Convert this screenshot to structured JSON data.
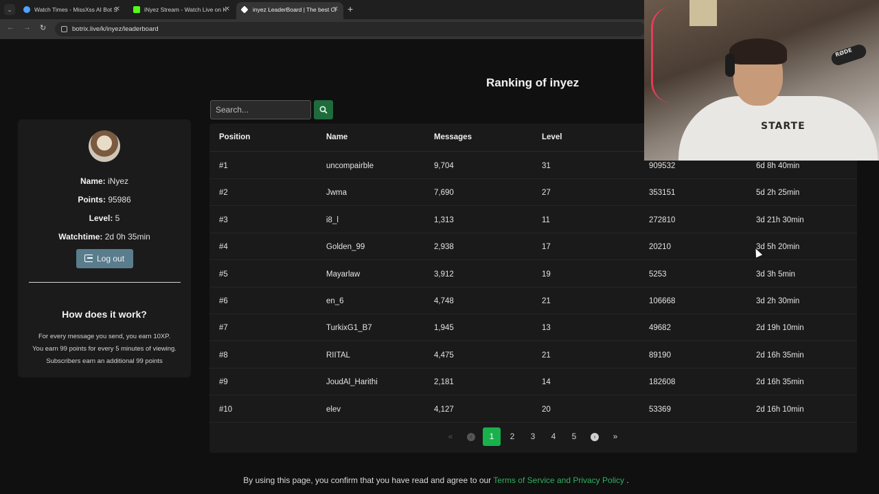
{
  "browser": {
    "tabs": [
      {
        "title": "Watch Times - MissXss AI Bot S",
        "fav_color": "#4da3ff",
        "active": false
      },
      {
        "title": "iNyez Stream - Watch Live on K",
        "fav_color": "#53fc18",
        "active": false
      },
      {
        "title": "inyez LeaderBoard | The best Cl",
        "fav_color": "#ffffff",
        "active": true
      }
    ],
    "url": "botrix.live/k/inyez/leaderboard"
  },
  "page": {
    "title": "Ranking of inyez",
    "search": {
      "placeholder": "Search..."
    },
    "profile": {
      "name_label": "Name:",
      "name_value": " iNyez",
      "points_label": "Points:",
      "points_value": " 95986",
      "level_label": "Level:",
      "level_value": " 5",
      "watchtime_label": "Watchtime:",
      "watchtime_value": " 2d 0h 35min",
      "logout_label": "Log out",
      "how_title": "How does it work?",
      "how_lines": [
        "For every message you send, you earn 10XP.",
        "You earn 99 points for every 5 minutes of viewing.",
        "Subscribers earn an additional 99 points"
      ]
    },
    "table": {
      "headers": [
        "Position",
        "Name",
        "Messages",
        "Level"
      ],
      "rows": [
        [
          "#1",
          "uncompairble",
          "9,704",
          "31",
          "909532",
          "6d 8h 40min"
        ],
        [
          "#2",
          "Jwma",
          "7,690",
          "27",
          "353151",
          "5d 2h 25min"
        ],
        [
          "#3",
          "i8_l",
          "1,313",
          "11",
          "272810",
          "3d 21h 30min"
        ],
        [
          "#4",
          "Golden_99",
          "2,938",
          "17",
          "20210",
          "3d 5h 20min"
        ],
        [
          "#5",
          "Mayarlaw",
          "3,912",
          "19",
          "5253",
          "3d 3h 5min"
        ],
        [
          "#6",
          "en_6",
          "4,748",
          "21",
          "106668",
          "3d 2h 30min"
        ],
        [
          "#7",
          "TurkixG1_B7",
          "1,945",
          "13",
          "49682",
          "2d 19h 10min"
        ],
        [
          "#8",
          "RIITAL",
          "4,475",
          "21",
          "89190",
          "2d 16h 35min"
        ],
        [
          "#9",
          "JoudAl_Harithi",
          "2,181",
          "14",
          "182608",
          "2d 16h 35min"
        ],
        [
          "#10",
          "elev",
          "4,127",
          "20",
          "53369",
          "2d 16h 10min"
        ]
      ]
    },
    "pagination": {
      "pages": [
        "1",
        "2",
        "3",
        "4",
        "5"
      ],
      "current": "1",
      "first": "«",
      "prev": "‹",
      "next": "›",
      "last": "»"
    },
    "footer": {
      "text": "By using this page, you confirm that you have read and agree to our ",
      "link": "Terms of Service and Privacy Policy",
      "end": " ."
    }
  },
  "webcam": {
    "hoodie_text": "STARTE",
    "mic_label": "RØDE"
  },
  "colors": {
    "accent": "#18b14c",
    "link": "#2fb163",
    "logout": "#5a7d8e"
  }
}
